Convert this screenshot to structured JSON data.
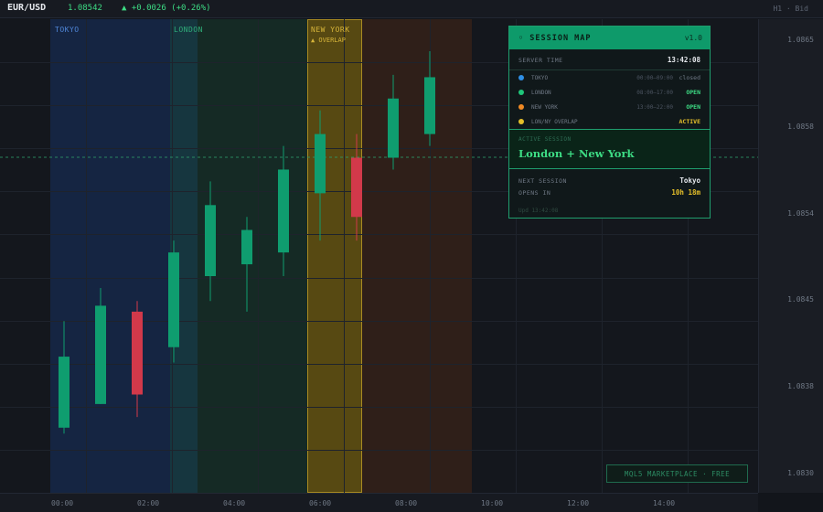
{
  "topbar": {
    "symbol": "EUR/USD",
    "price": "1.08542",
    "change": "▲ +0.0026 (+0.26%)",
    "mode": "H1 · Bid"
  },
  "sessions": [
    {
      "name": "TOKYO",
      "color": "#2f6fd6"
    },
    {
      "name": "LONDON",
      "color": "#1fae7a"
    },
    {
      "name": "NEW YORK",
      "color": "#d7b53a"
    }
  ],
  "overlap_label": "▲ OVERLAP",
  "price_axis": [
    "1.0865",
    "1.0858",
    "1.0854",
    "1.0845",
    "1.0838",
    "1.0830"
  ],
  "time_axis": [
    "00:00",
    "02:00",
    "04:00",
    "06:00",
    "08:00",
    "10:00",
    "12:00",
    "14:00"
  ],
  "panel": {
    "title": "◦ SESSION MAP",
    "version": "v1.0",
    "server_time_label": "SERVER TIME",
    "server_time": "13:42:08",
    "sessions": [
      {
        "name": "TOKYO",
        "hours": "00:00–09:00",
        "status": "closed",
        "dot": "#2f8fe6",
        "status_color": "#6f7885"
      },
      {
        "name": "LONDON",
        "hours": "08:00–17:00",
        "status": "OPEN",
        "dot": "#1fc77a",
        "status_color": "#3ddc84"
      },
      {
        "name": "NEW YORK",
        "hours": "13:00–22:00",
        "status": "OPEN",
        "dot": "#f08a24",
        "status_color": "#3ddc84"
      },
      {
        "name": "LON/NY OVERLAP",
        "hours": "",
        "status": "ACTIVE",
        "dot": "#e6c02a",
        "status_color": "#e6c02a"
      }
    ],
    "active_caption": "ACTIVE SESSION",
    "active_value": "London + New York",
    "next_label": "NEXT SESSION",
    "next_value": "Tokyo",
    "opens_label": "OPENS IN",
    "opens_value": "10h 18m",
    "footer": "Upd 13:42:08"
  },
  "badge": "MQL5 MARKETPLACE · FREE",
  "chart_data": {
    "type": "candlestick",
    "ylim": [
      1.0828,
      1.0868
    ],
    "candles": [
      {
        "o": 1.08335,
        "h": 1.08425,
        "l": 1.0833,
        "c": 1.08395
      },
      {
        "o": 1.08355,
        "h": 1.08453,
        "l": 1.08355,
        "c": 1.08438
      },
      {
        "o": 1.08433,
        "h": 1.08442,
        "l": 1.08344,
        "c": 1.08363
      },
      {
        "o": 1.08403,
        "h": 1.08493,
        "l": 1.0839,
        "c": 1.08483
      },
      {
        "o": 1.08463,
        "h": 1.08543,
        "l": 1.08442,
        "c": 1.08523
      },
      {
        "o": 1.08473,
        "h": 1.08513,
        "l": 1.08433,
        "c": 1.08502
      },
      {
        "o": 1.08483,
        "h": 1.08573,
        "l": 1.08463,
        "c": 1.08553
      },
      {
        "o": 1.08533,
        "h": 1.08603,
        "l": 1.08493,
        "c": 1.08583
      },
      {
        "o": 1.08563,
        "h": 1.08583,
        "l": 1.08493,
        "c": 1.08513
      },
      {
        "o": 1.08563,
        "h": 1.08633,
        "l": 1.08553,
        "c": 1.08613
      },
      {
        "o": 1.08583,
        "h": 1.08653,
        "l": 1.08573,
        "c": 1.08631
      }
    ],
    "up_color": "#0f9d6f",
    "down_color": "#d2394a"
  }
}
